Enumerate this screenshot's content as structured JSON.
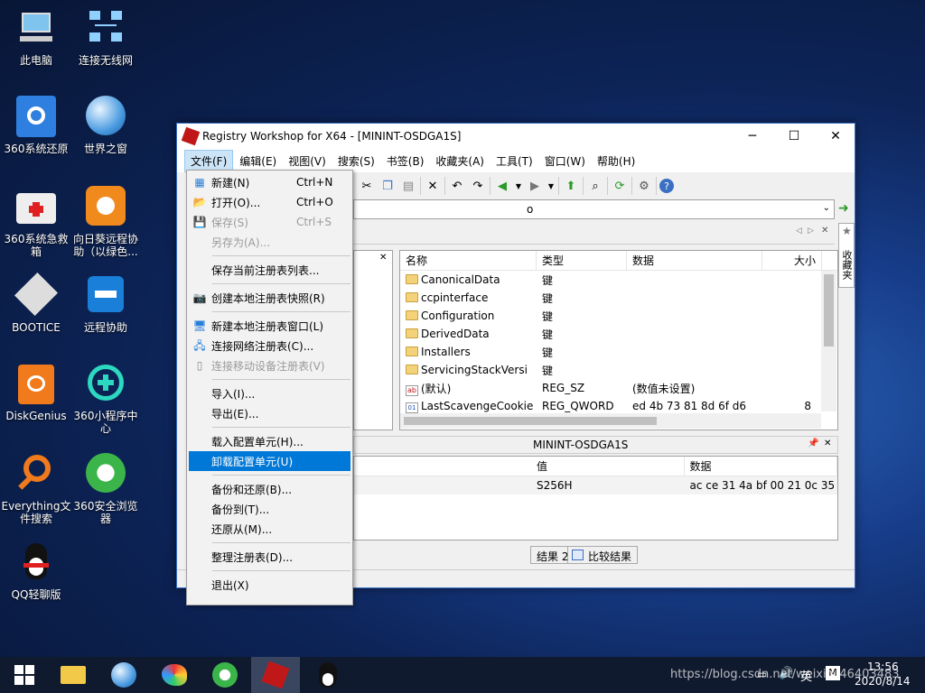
{
  "desktop": {
    "icons": [
      "此电脑",
      "连接无线网",
      "360系统还原",
      "世界之窗",
      "360系统急救箱",
      "向日葵远程协助（以绿色...",
      "BOOTICE",
      "远程协助",
      "DiskGenius",
      "360小程序中心",
      "Everything文件搜索",
      "360安全浏览器",
      "QQ轻聊版"
    ]
  },
  "window": {
    "title": "Registry Workshop for X64 - [MININT-OSDGA1S]",
    "minimize": "─",
    "maximize": "☐",
    "close": "✕"
  },
  "menubar": [
    "文件(F)",
    "编辑(E)",
    "视图(V)",
    "搜索(S)",
    "书签(B)",
    "收藏夹(A)",
    "工具(T)",
    "窗口(W)",
    "帮助(H)"
  ],
  "address": {
    "value": "o"
  },
  "right_panel": {
    "tab_label": "收藏夹"
  },
  "list": {
    "headers": [
      "名称",
      "类型",
      "数据",
      "大小"
    ],
    "rows": [
      {
        "name": "CanonicalData",
        "type": "键",
        "data": "",
        "size": ""
      },
      {
        "name": "ccpinterface",
        "type": "键",
        "data": "",
        "size": ""
      },
      {
        "name": "Configuration",
        "type": "键",
        "data": "",
        "size": ""
      },
      {
        "name": "DerivedData",
        "type": "键",
        "data": "",
        "size": ""
      },
      {
        "name": "Installers",
        "type": "键",
        "data": "",
        "size": ""
      },
      {
        "name": "ServicingStackVersi",
        "type": "键",
        "data": "",
        "size": ""
      },
      {
        "name": "(默认)",
        "type": "REG_SZ",
        "data": "(数值未设置)",
        "size": ""
      },
      {
        "name": "LastScavengeCookie",
        "type": "REG_QWORD",
        "data": "ed 4b 73 81 8d 6f d6",
        "size": "8"
      }
    ]
  },
  "bottom": {
    "title": "MININT-OSDGA1S",
    "headers": [
      "值",
      "数据"
    ],
    "row": {
      "value": "S256H",
      "data": "ac ce 31 4a bf 00 21 0c 35 7d 7..."
    },
    "tab1": "结果 2",
    "tab2": "比较结果"
  },
  "file_menu": {
    "items": [
      {
        "label": "新建(N)",
        "shortcut": "Ctrl+N",
        "icon": "new-icon",
        "state": "normal"
      },
      {
        "label": "打开(O)...",
        "shortcut": "Ctrl+O",
        "icon": "open-icon",
        "state": "normal"
      },
      {
        "label": "保存(S)",
        "shortcut": "Ctrl+S",
        "icon": "save-icon",
        "state": "disabled"
      },
      {
        "label": "另存为(A)...",
        "shortcut": "",
        "icon": "",
        "state": "disabled"
      },
      {
        "sep": true
      },
      {
        "label": "保存当前注册表列表...",
        "shortcut": "",
        "icon": "",
        "state": "normal"
      },
      {
        "sep": true
      },
      {
        "label": "创建本地注册表快照(R)",
        "shortcut": "",
        "icon": "camera-icon",
        "state": "normal"
      },
      {
        "sep": true
      },
      {
        "label": "新建本地注册表窗口(L)",
        "shortcut": "",
        "icon": "computer-icon",
        "state": "normal"
      },
      {
        "label": "连接网络注册表(C)...",
        "shortcut": "",
        "icon": "network-icon",
        "state": "normal"
      },
      {
        "label": "连接移动设备注册表(V)",
        "shortcut": "",
        "icon": "device-icon",
        "state": "disabled"
      },
      {
        "sep": true
      },
      {
        "label": "导入(I)...",
        "shortcut": "",
        "icon": "",
        "state": "normal"
      },
      {
        "label": "导出(E)...",
        "shortcut": "",
        "icon": "",
        "state": "normal"
      },
      {
        "sep": true
      },
      {
        "label": "载入配置单元(H)...",
        "shortcut": "",
        "icon": "",
        "state": "normal"
      },
      {
        "label": "卸载配置单元(U)",
        "shortcut": "",
        "icon": "",
        "state": "highlighted"
      },
      {
        "sep": true
      },
      {
        "label": "备份和还原(B)...",
        "shortcut": "",
        "icon": "",
        "state": "normal"
      },
      {
        "label": "备份到(T)...",
        "shortcut": "",
        "icon": "",
        "state": "normal"
      },
      {
        "label": "还原从(M)...",
        "shortcut": "",
        "icon": "",
        "state": "normal"
      },
      {
        "sep": true
      },
      {
        "label": "整理注册表(D)...",
        "shortcut": "",
        "icon": "",
        "state": "normal"
      },
      {
        "sep": true
      },
      {
        "label": "退出(X)",
        "shortcut": "",
        "icon": "",
        "state": "normal"
      }
    ]
  },
  "taskbar": {
    "time": "13:56",
    "date": "2020/8/14",
    "ime": "英",
    "watermark": "https://blog.csdn.net/weixin_46403483"
  }
}
